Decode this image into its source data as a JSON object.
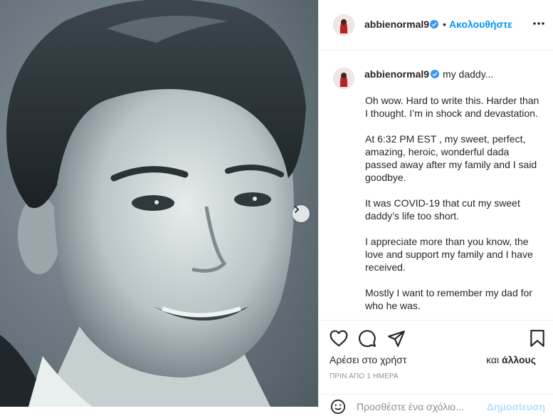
{
  "post": {
    "username": "abbienormal9",
    "follow_separator": "•",
    "follow_label": "Ακολουθήστε",
    "caption_headline": "my daddy...",
    "caption_paragraphs": [
      "Oh wow. Hard to write this. Harder than I thought. I’m in shock and devastation.",
      "At 6:32 PM EST , my sweet, perfect, amazing, heroic, wonderful dada passed away after my family and I said goodbye.",
      "It was COVID-19 that cut my sweet daddy’s life too short.",
      "I appreciate more than you know, the love and support my family and I have received.",
      "Mostly I want to remember my dad for who he was."
    ],
    "likes_left": "Αρέσει στο χρήστ",
    "likes_right_prefix": "και",
    "likes_right_bold": "άλλους",
    "timestamp": "ΠΡΙΝ ΑΠΟ 1 ΗΜΕΡΑ",
    "comment_placeholder": "Προσθέστε ένα σχόλιο...",
    "post_label": "Δημοσίευση"
  },
  "icons": {
    "verified": "verified-badge-icon",
    "more": "more-options-icon",
    "like": "heart-icon",
    "comment": "comment-bubble-icon",
    "share": "paper-plane-icon",
    "save": "bookmark-icon",
    "next": "chevron-right-icon",
    "emoji": "emoji-icon"
  },
  "colors": {
    "accent": "#0095f6",
    "verified": "#3897f0",
    "text": "#262626",
    "muted": "#8e8e8e",
    "divider": "#efefef"
  }
}
